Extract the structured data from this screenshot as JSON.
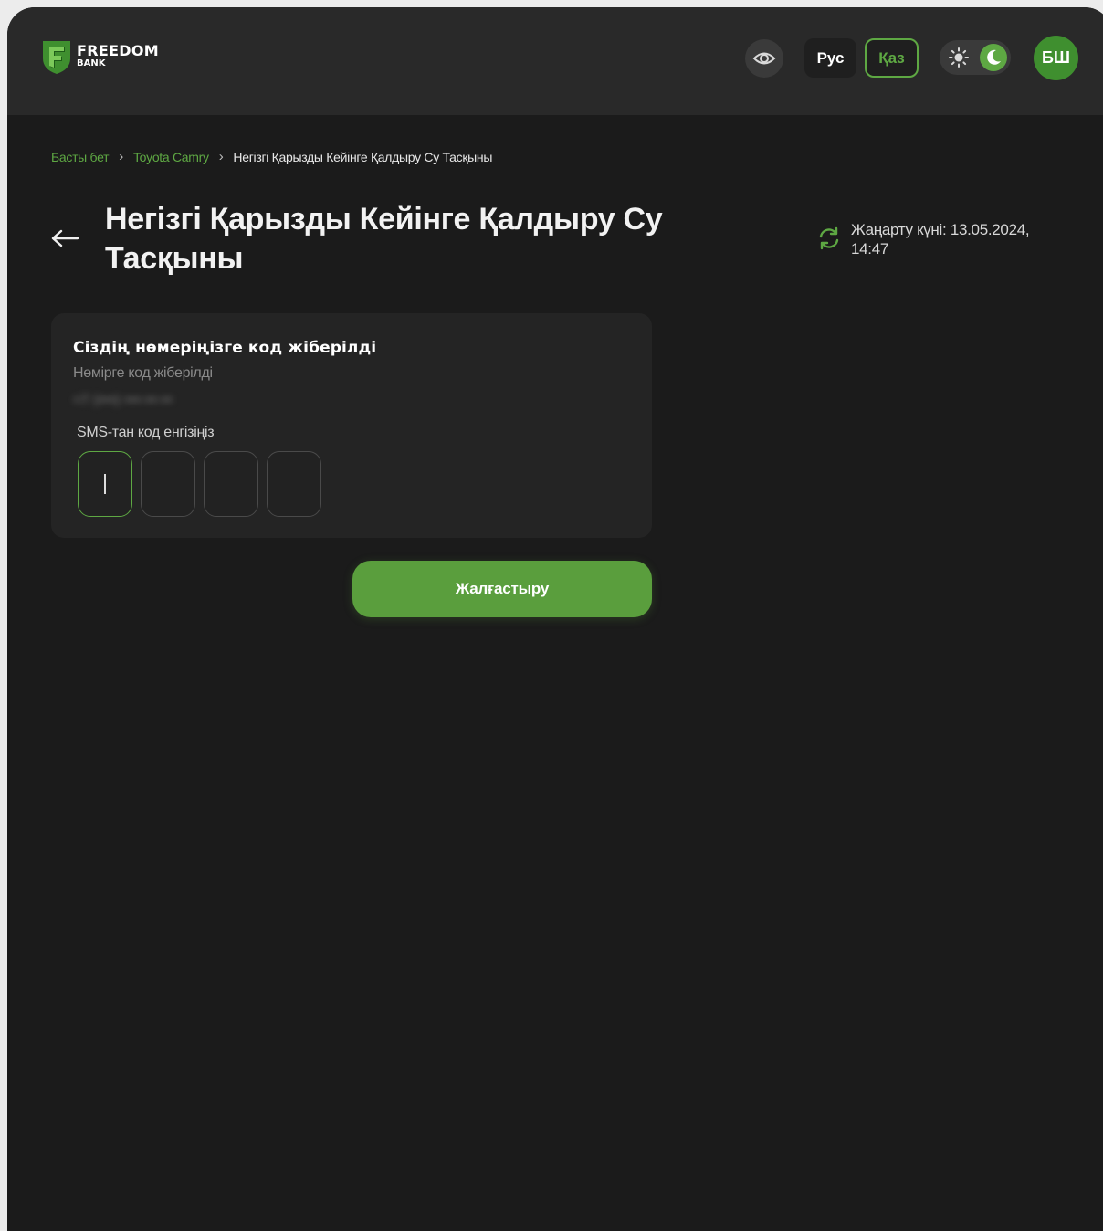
{
  "brand": {
    "line1": "FREEDOM",
    "line2": "BANK"
  },
  "header": {
    "lang_ru": "Рус",
    "lang_kz": "Қаз",
    "avatar_initials": "БШ"
  },
  "breadcrumb": {
    "items": [
      "Басты бет",
      "Toyota Camry"
    ],
    "current": "Негізгі Қарызды Кейінге Қалдыру Су Тасқыны"
  },
  "page": {
    "title": "Негізгі Қарызды Кейінге Қалдыру Су Тасқыны",
    "updated": "Жаңарту күні: 13.05.2024, 14:47"
  },
  "card": {
    "title": "Сіздің нөмеріңізге код жіберілді",
    "subtitle": "Нөмірге код жіберілді",
    "masked_phone": "+7 (•••) •••-••-••",
    "sms_label": "SMS-тан код енгізіңіз"
  },
  "buttons": {
    "continue": "Жалғастыру"
  },
  "colors": {
    "accent": "#5ea843",
    "background": "#1b1b1b",
    "header": "#292929"
  }
}
